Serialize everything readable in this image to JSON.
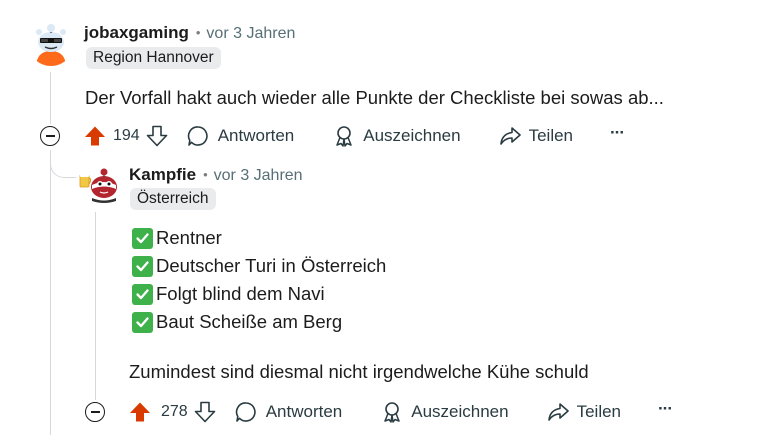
{
  "comments": [
    {
      "username": "jobaxgaming",
      "time": "vor 3 Jahren",
      "flair": "Region Hannover",
      "text": "Der Vorfall hakt auch wieder alle Punkte der Checkliste bei sowas ab...",
      "votes": "194",
      "actions": {
        "reply": "Antworten",
        "award": "Auszeichnen",
        "share": "Teilen",
        "more": "···"
      }
    },
    {
      "username": "Kampfie",
      "time": "vor 3 Jahren",
      "flair": "Österreich",
      "checklist": [
        "Rentner",
        "Deutscher Turi in Österreich",
        "Folgt blind dem Navi",
        "Baut Scheiße am Berg"
      ],
      "text": "Zumindest sind diesmal nicht irgendwelche Kühe schuld",
      "votes": "278",
      "actions": {
        "reply": "Antworten",
        "award": "Auszeichnen",
        "share": "Teilen",
        "more": "···"
      }
    }
  ],
  "colors": {
    "upvote_active": "#d93a00",
    "check_green": "#3fb14a",
    "flair_bg": "#e9ebed"
  },
  "icons": [
    "upvote-icon",
    "downvote-icon",
    "comment-icon",
    "award-icon",
    "share-icon",
    "more-icon",
    "collapse-icon",
    "check-icon"
  ]
}
